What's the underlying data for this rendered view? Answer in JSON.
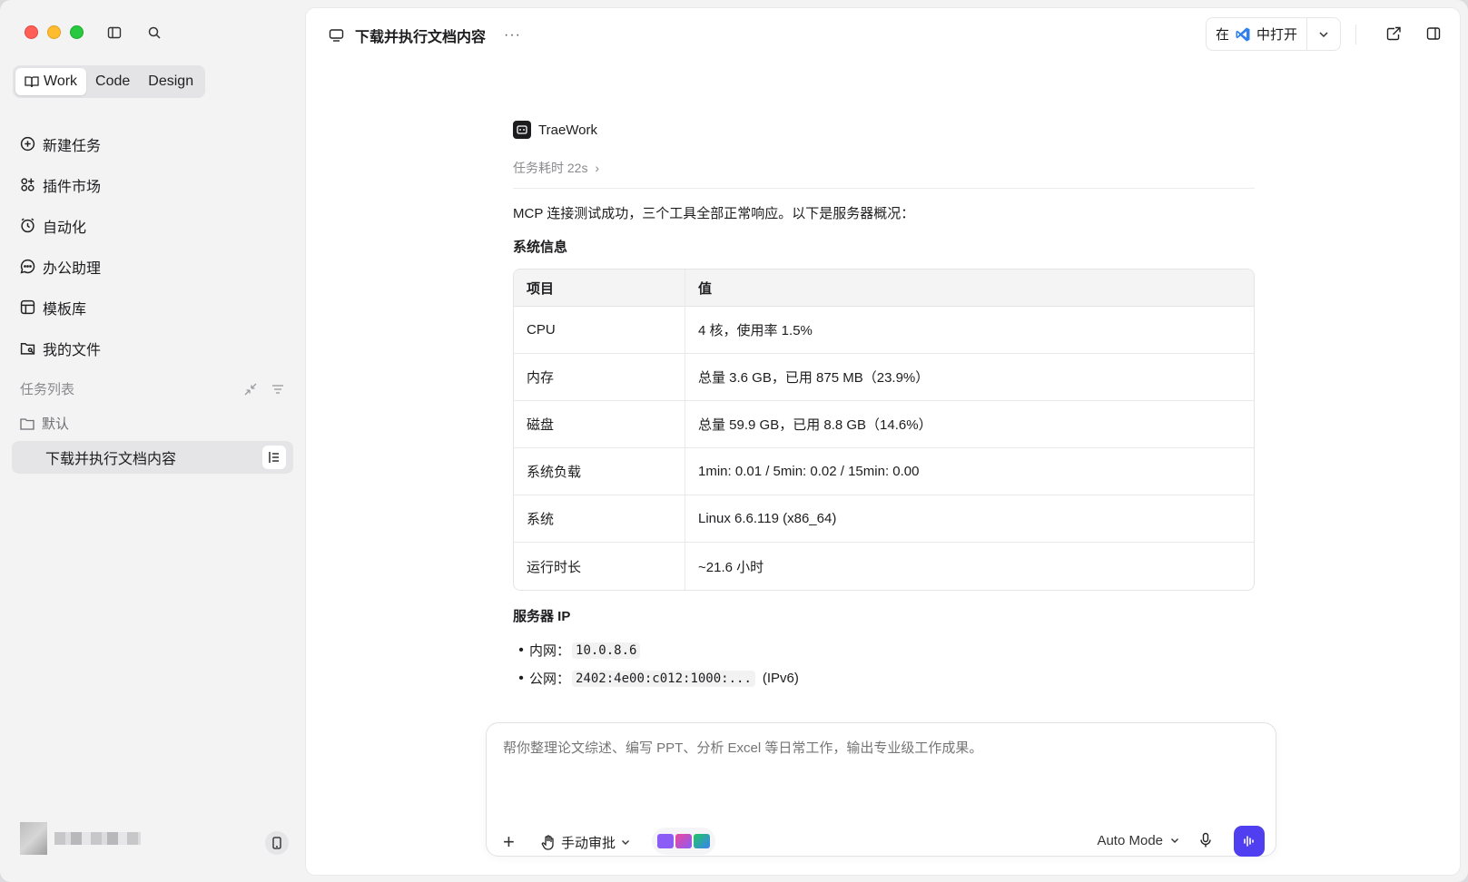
{
  "sidebar": {
    "modes": [
      {
        "label": "Work",
        "active": true
      },
      {
        "label": "Code",
        "active": false
      },
      {
        "label": "Design",
        "active": false
      }
    ],
    "nav": [
      {
        "label": "新建任务",
        "icon": "plus-circle-icon"
      },
      {
        "label": "插件市场",
        "icon": "plugins-icon"
      },
      {
        "label": "自动化",
        "icon": "clock-icon"
      },
      {
        "label": "办公助理",
        "icon": "chat-icon"
      },
      {
        "label": "模板库",
        "icon": "template-icon"
      },
      {
        "label": "我的文件",
        "icon": "files-icon"
      }
    ],
    "section_title": "任务列表",
    "folder": "默认",
    "active_task": "下载并执行文档内容"
  },
  "topbar": {
    "title": "下载并执行文档内容",
    "more": "···",
    "open_in_prefix": "在",
    "open_in_suffix": "中打开"
  },
  "message": {
    "agent": "TraeWork",
    "duration": "任务耗时 22s",
    "intro": "MCP 连接测试成功，三个工具全部正常响应。以下是服务器概况：",
    "system_heading": "系统信息",
    "table": {
      "headers": [
        "项目",
        "值"
      ],
      "rows": [
        [
          "CPU",
          "4 核，使用率 1.5%"
        ],
        [
          "内存",
          "总量 3.6 GB，已用 875 MB（23.9%）"
        ],
        [
          "磁盘",
          "总量 59.9 GB，已用 8.8 GB（14.6%）"
        ],
        [
          "系统负载",
          "1min: 0.01 / 5min: 0.02 / 15min: 0.00"
        ],
        [
          "系统",
          "Linux 6.6.119 (x86_64)"
        ],
        [
          "运行时长",
          "~21.6 小时"
        ]
      ]
    },
    "ip_heading": "服务器 IP",
    "ip": {
      "intranet_label": "内网：",
      "intranet_value": "10.0.8.6",
      "public_label": "公网：",
      "public_value": "2402:4e00:c012:1000:...",
      "public_suffix": "(IPv6)"
    }
  },
  "composer": {
    "placeholder": "帮你整理论文综述、编写 PPT、分析 Excel 等日常工作，输出专业级工作成果。",
    "approval": "手动审批",
    "mode": "Auto Mode"
  },
  "colors": {
    "send_button": "#4f3ff0",
    "vscode_blue": "#2f80ed"
  }
}
